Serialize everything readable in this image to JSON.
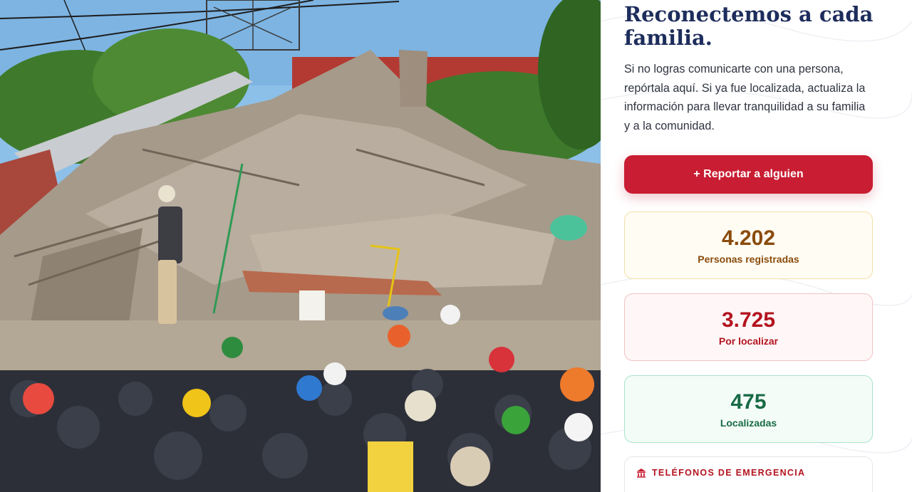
{
  "hero": {
    "title": "Reconectemos a cada familia.",
    "intro": "Si no logras comunicarte con una persona, repórtala aquí. Si ya fue localizada, actualiza la información para llevar tranquilidad a su familia y a la comunidad."
  },
  "actions": {
    "report_label": "+ Reportar a alguien"
  },
  "stats": {
    "registered": {
      "value": "4.202",
      "label": "Personas registradas"
    },
    "pending": {
      "value": "3.725",
      "label": "Por localizar"
    },
    "located": {
      "value": "475",
      "label": "Localizadas"
    }
  },
  "emergency": {
    "icon": "building-icon",
    "title": "TELÉFONOS DE EMERGENCIA"
  },
  "colors": {
    "title": "#1d2d5c",
    "accent_red": "#c81d32",
    "registered": "#8a4b0c",
    "pending": "#b3141f",
    "located": "#176b46"
  }
}
